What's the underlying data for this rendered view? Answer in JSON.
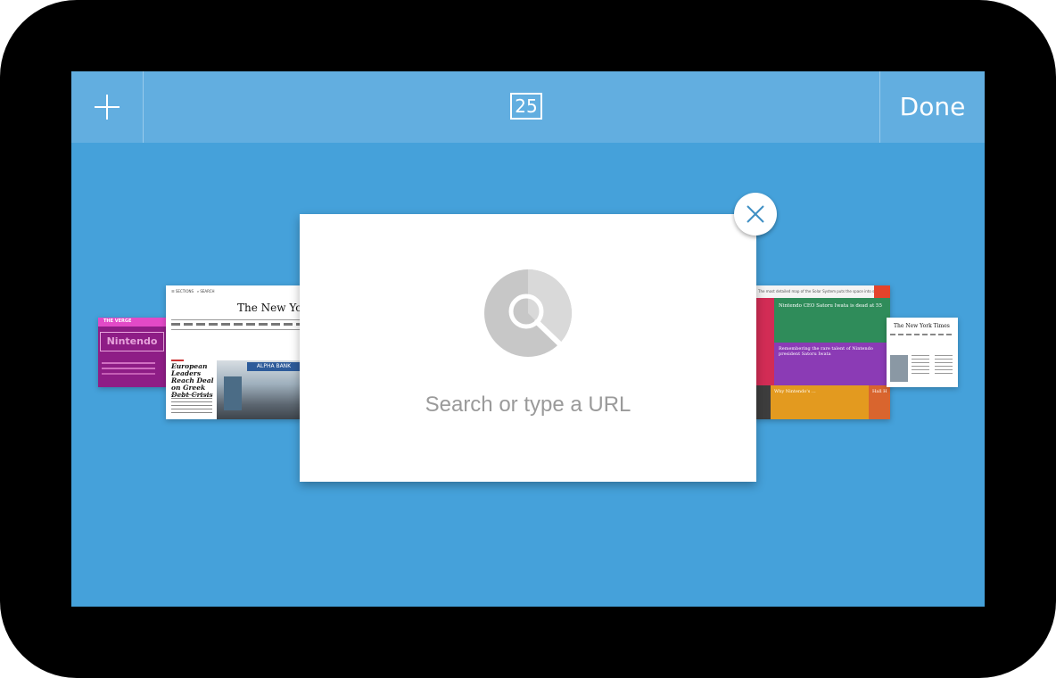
{
  "toolbar": {
    "add_icon": "plus-icon",
    "tab_count": "25",
    "done_label": "Done"
  },
  "new_tab_card": {
    "search_icon": "search-icon",
    "placeholder": "Search or type a URL",
    "close_icon": "close-icon"
  },
  "thumbnails": {
    "left_far": {
      "badge": "THE VERGE",
      "brand": "Nintendo"
    },
    "left": {
      "masthead": "The New York Times",
      "headline": "European Leaders Reach Deal on Greek Debt Crisis",
      "photo_sign": "ALPHA BANK"
    },
    "right": {
      "url_text": "The most detailed map of the Solar System puts the space into space",
      "headline_1": "Nintendo CEO Satoru Iwata is dead at 55",
      "headline_2": "Remembering the rare talent of Nintendo president Satoru Iwata",
      "headline_3": "Why Nintendo's ...",
      "headline_4": "Hall H"
    },
    "right_far": {
      "masthead": "The New York Times"
    }
  },
  "colors": {
    "background": "#45a1da",
    "toolbar": "#62aee0",
    "device_frame": "#000000"
  }
}
